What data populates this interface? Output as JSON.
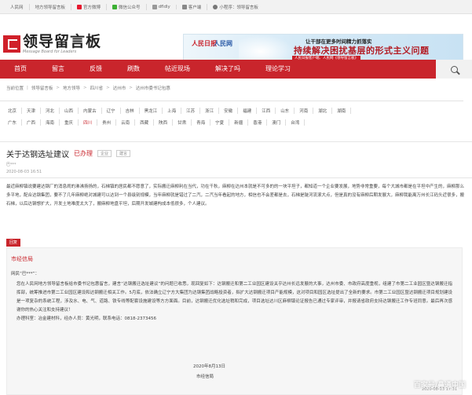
{
  "topbar": {
    "items": [
      {
        "label": "人民网",
        "icon": "none"
      },
      {
        "label": "地方领导留言板",
        "icon": "none"
      },
      {
        "label": "官方微博",
        "icon": "weibo-icon"
      },
      {
        "label": "微信公众号",
        "icon": "wechat-icon"
      },
      {
        "label": "dfldly",
        "icon": "app-icon"
      },
      {
        "label": "客户端",
        "icon": "phone-icon"
      },
      {
        "label": "小程序：领导留言板",
        "icon": "mini-program-icon"
      }
    ]
  },
  "logo": {
    "cn": "领导留言板",
    "en": "Message Board for Leaders"
  },
  "banner": {
    "brand1": "人民日报",
    "brand2": "人民网",
    "line1": "让干部在更多时间精力抓落实",
    "line2": "持续解决困扰基层的形式主义问题",
    "line3": "人民日报客户端、人民网《领导留言板》"
  },
  "nav": {
    "items": [
      "首页",
      "留言",
      "反馈",
      "刷数",
      "帖近现场",
      "解决了吗",
      "理论学习"
    ]
  },
  "breadcrumb": [
    "当前位置",
    "领导留言板",
    "地方领导",
    "四川省",
    "达州市",
    "达州市委书记包惠"
  ],
  "regions": {
    "row1": [
      "北京",
      "天津",
      "河北",
      "山西",
      "内蒙古",
      "辽宁",
      "吉林",
      "黑龙江",
      "上海",
      "江苏",
      "浙江",
      "安徽",
      "福建",
      "江西",
      "山东",
      "河南",
      "湖北",
      "湖南"
    ],
    "row2": [
      "广东",
      "广西",
      "海南",
      "重庆",
      "四川",
      "贵州",
      "云南",
      "西藏",
      "陕西",
      "甘肃",
      "青海",
      "宁夏",
      "新疆",
      "香港",
      "澳门",
      "台湾"
    ],
    "selected": "四川"
  },
  "post": {
    "title": "关于达钢选址建议",
    "status": "已办理",
    "tags": [
      "企业",
      "建言"
    ],
    "author": "巴***",
    "time": "2020-08-03 16:51",
    "content": "最近麻柳镇说要建达钢厂的消息闹的沸沸扬扬的，石梯镇的居民都不愿意了，实际搬迁麻柳利在当代，功在千秋，麻柳在达州本就是不可多的的一块平坦子，都知道一个企业要发展，地势非常重要，每个大城市都是在平坦中产生的，麻柳那么多平地，配合达钢集团，要不了几年麻柳绝对城建可以达到一个县级别规模，当年麻柳就是错过了二汽，二汽当年看起的地方，相信也不会差都是去，石梯是陡河流滚大点，但是真的没有麻柳后期发展大，麻柳我能离万州长江码头近很多，搬石梯，以后达钢想扩大，开发土地难度太大了，搬麻柳地盘平坦，后期开发城建构成本低很多，个人建议。"
  },
  "reply": {
    "tag": "回复",
    "org": "市经信局",
    "to": "网民“巴***”：",
    "body": "您在人民网地方领导留言板给市委书记包惠留言，建言“达钢搬迁选址建议”的问题已收悉，现回复如下：达钢搬迁和第二工业园区建设关乎达州长远发展的大事，达州市委、市政府高度重视，组建了市第二工业园区暨达钢搬迁指挥部，统筹推进市第二工业园区建设和达钢搬迁相关工作。5月底，依法确立辽宁方大集团为达钢集团战略投资者，拟扩大达钢搬迁项目产能规模，这对项目和园区选址提出了全新的要求。市第二工业园区暨达钢搬迁项目规划建设是一项复杂的系统工程，涉及水、电、气、道路、铁专线等配套设施建设等方方面面。目前，达钢搬迁优化选址稍和完成，项目选址达川区麻柳镇论证报告已通过专家评审，并报请省政府支持达钢搬迁工作专班同意。最后再次感谢你的热心关注和支持建议！",
    "handler": "办理科室：冶金建材科，经办人员：黄光明，联系电话：",
    "phone": "0818-2373456",
    "date": "2020年8月13日",
    "sign": "市经信局",
    "reply_time": "2020-08-13 17:31"
  },
  "watermark": "百家号/鼻通中国"
}
